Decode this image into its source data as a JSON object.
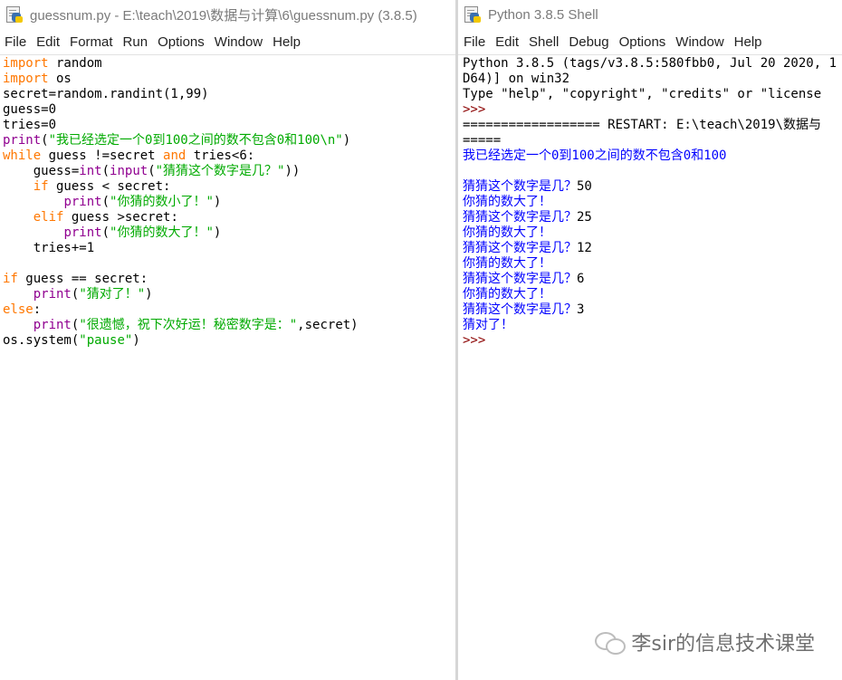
{
  "editor": {
    "title": "guessnum.py - E:\\teach\\2019\\数据与计算\\6\\guessnum.py (3.8.5)",
    "menu": [
      "File",
      "Edit",
      "Format",
      "Run",
      "Options",
      "Window",
      "Help"
    ],
    "lines": [
      [
        {
          "t": "import",
          "c": "kw"
        },
        {
          "t": " random"
        }
      ],
      [
        {
          "t": "import",
          "c": "kw"
        },
        {
          "t": " os"
        }
      ],
      [
        {
          "t": "secret=random.randint(1,99)"
        }
      ],
      [
        {
          "t": "guess=0"
        }
      ],
      [
        {
          "t": "tries=0"
        }
      ],
      [
        {
          "t": "print",
          "c": "bi"
        },
        {
          "t": "("
        },
        {
          "t": "\"我已经选定一个0到100之间的数不包含0和100\\n\"",
          "c": "st"
        },
        {
          "t": ")"
        }
      ],
      [
        {
          "t": "while",
          "c": "kw"
        },
        {
          "t": " guess !=secret "
        },
        {
          "t": "and",
          "c": "kw"
        },
        {
          "t": " tries<6:"
        }
      ],
      [
        {
          "t": "    guess="
        },
        {
          "t": "int",
          "c": "bi"
        },
        {
          "t": "("
        },
        {
          "t": "input",
          "c": "bi"
        },
        {
          "t": "("
        },
        {
          "t": "\"猜猜这个数字是几？\"",
          "c": "st"
        },
        {
          "t": "))"
        }
      ],
      [
        {
          "t": "    "
        },
        {
          "t": "if",
          "c": "kw"
        },
        {
          "t": " guess < secret:"
        }
      ],
      [
        {
          "t": "        "
        },
        {
          "t": "print",
          "c": "bi"
        },
        {
          "t": "("
        },
        {
          "t": "\"你猜的数小了！\"",
          "c": "st"
        },
        {
          "t": ")"
        }
      ],
      [
        {
          "t": "    "
        },
        {
          "t": "elif",
          "c": "kw"
        },
        {
          "t": " guess >secret:"
        }
      ],
      [
        {
          "t": "        "
        },
        {
          "t": "print",
          "c": "bi"
        },
        {
          "t": "("
        },
        {
          "t": "\"你猜的数大了！\"",
          "c": "st"
        },
        {
          "t": ")"
        }
      ],
      [
        {
          "t": "    tries+=1"
        }
      ],
      [
        {
          "t": ""
        }
      ],
      [
        {
          "t": "if",
          "c": "kw"
        },
        {
          "t": " guess == secret:"
        }
      ],
      [
        {
          "t": "    "
        },
        {
          "t": "print",
          "c": "bi"
        },
        {
          "t": "("
        },
        {
          "t": "\"猜对了！\"",
          "c": "st"
        },
        {
          "t": ")"
        }
      ],
      [
        {
          "t": "else",
          "c": "kw"
        },
        {
          "t": ":"
        }
      ],
      [
        {
          "t": "    "
        },
        {
          "t": "print",
          "c": "bi"
        },
        {
          "t": "("
        },
        {
          "t": "\"很遗憾，祝下次好运！秘密数字是：\"",
          "c": "st"
        },
        {
          "t": ",secret)"
        }
      ],
      [
        {
          "t": "os.system("
        },
        {
          "t": "\"pause\"",
          "c": "st"
        },
        {
          "t": ")"
        }
      ]
    ]
  },
  "shell": {
    "title": "Python 3.8.5 Shell",
    "menu": [
      "File",
      "Edit",
      "Shell",
      "Debug",
      "Options",
      "Window",
      "Help"
    ],
    "lines": [
      [
        {
          "t": "Python 3.8.5 (tags/v3.8.5:580fbb0, Jul 20 2020, 1"
        }
      ],
      [
        {
          "t": "D64)] on win32"
        }
      ],
      [
        {
          "t": "Type \"help\", \"copyright\", \"credits\" or \"license"
        }
      ],
      [
        {
          "t": ">>>",
          "c": "prompt"
        }
      ],
      [
        {
          "t": "================== RESTART: E:\\teach\\2019\\数据与"
        }
      ],
      [
        {
          "t": "====="
        }
      ],
      [
        {
          "t": "我已经选定一个0到100之间的数不包含0和100",
          "c": "out"
        }
      ],
      [
        {
          "t": ""
        }
      ],
      [
        {
          "t": "猜猜这个数字是几？",
          "c": "out"
        },
        {
          "t": "50"
        }
      ],
      [
        {
          "t": "你猜的数大了！",
          "c": "out"
        }
      ],
      [
        {
          "t": "猜猜这个数字是几？",
          "c": "out"
        },
        {
          "t": "25"
        }
      ],
      [
        {
          "t": "你猜的数大了！",
          "c": "out"
        }
      ],
      [
        {
          "t": "猜猜这个数字是几？",
          "c": "out"
        },
        {
          "t": "12"
        }
      ],
      [
        {
          "t": "你猜的数大了！",
          "c": "out"
        }
      ],
      [
        {
          "t": "猜猜这个数字是几？",
          "c": "out"
        },
        {
          "t": "6"
        }
      ],
      [
        {
          "t": "你猜的数大了！",
          "c": "out"
        }
      ],
      [
        {
          "t": "猜猜这个数字是几？",
          "c": "out"
        },
        {
          "t": "3"
        }
      ],
      [
        {
          "t": "猜对了！",
          "c": "out"
        }
      ],
      [
        {
          "t": ">>>",
          "c": "prompt"
        }
      ]
    ]
  },
  "watermark": {
    "text": "李sir的信息技术课堂"
  }
}
